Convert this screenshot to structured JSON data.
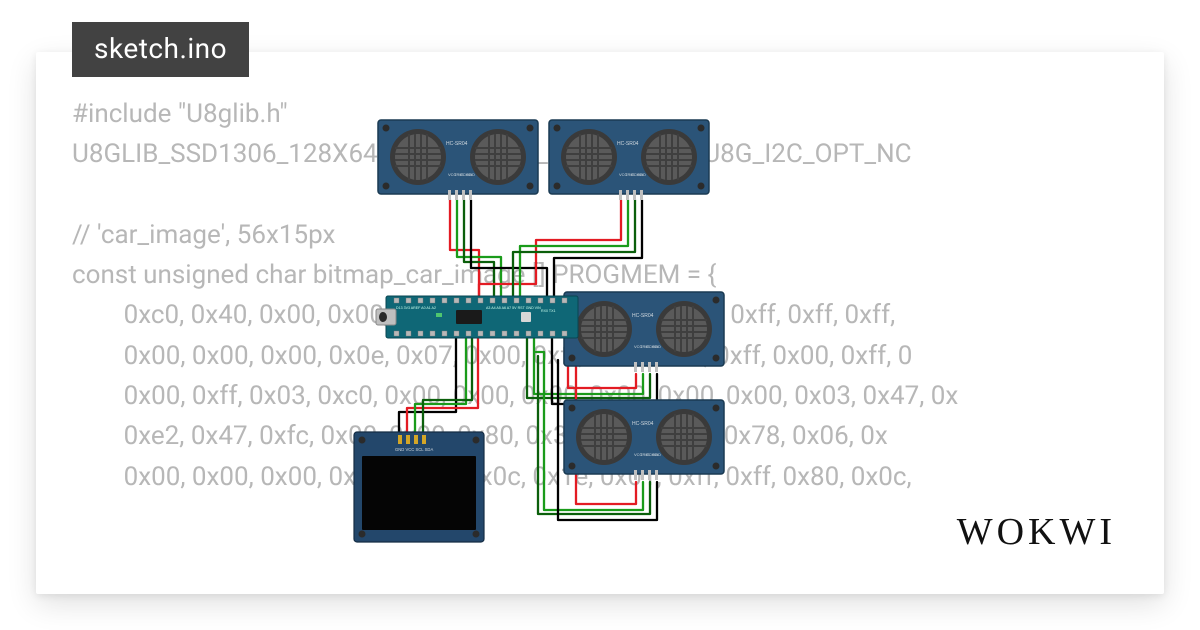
{
  "tab_title": "sketch.ino",
  "brand": "WOKWI",
  "code_lines": [
    "#include \"U8glib.h\"",
    "U8GLIB_SSD1306_128X64 u8g(U8G_I2C_OPT_DEV_0 | U8G_I2C_OPT_NC",
    "",
    "// 'car_image', 56x15px",
    "const unsigned char bitmap_car_image [] PROGMEM = {",
    "        0xc0, 0x40, 0x00, 0x00, 0x00, 0x02, 0x03, 0xc0, 0x8f, 0xff, 0xff, 0xff,",
    "        0x00, 0x00, 0x00, 0x0e, 0x07, 0x00, 0xff, 0x80, 0xff, 0xff, 0x00, 0xff, 0",
    "        0x00, 0xff, 0x03, 0xc0, 0x00, 0x00, 0x00, 0x00, 0x00, 0x00, 0x03, 0x47, 0x",
    "        0xe2, 0x47, 0xfc, 0x00, 0x00, 0x80, 0x3f, 0xe2, 0x40, 0x78, 0x06, 0x",
    "        0x00, 0x00, 0x00, 0x00, 0x00, 0x0c, 0x1e, 0x01, 0xff, 0xff, 0x80, 0x0c,"
  ],
  "components": {
    "arduino": "Arduino Nano",
    "sensors": [
      "HC-SR04",
      "HC-SR04",
      "HC-SR04",
      "HC-SR04"
    ],
    "sensor_pins": [
      "VCC",
      "TRIG",
      "ECHO",
      "GND"
    ],
    "display": "SSD1306 OLED",
    "display_pins": [
      "GND",
      "VCC",
      "SCL",
      "SDA"
    ],
    "nano_top_labels": "D13 3V3 AREF A0 A1 A2 A3 A4 A5 A6 A7 5V RST GND VIN",
    "nano_bot_labels": "D12 D11 D10 D9 D8 D7 D6 D5 D4 D3 D2 GND RST RX0 TX1"
  },
  "wire_colors": {
    "power": "#e31b23",
    "ground": "#000000",
    "signal": "#1a9b1a"
  }
}
